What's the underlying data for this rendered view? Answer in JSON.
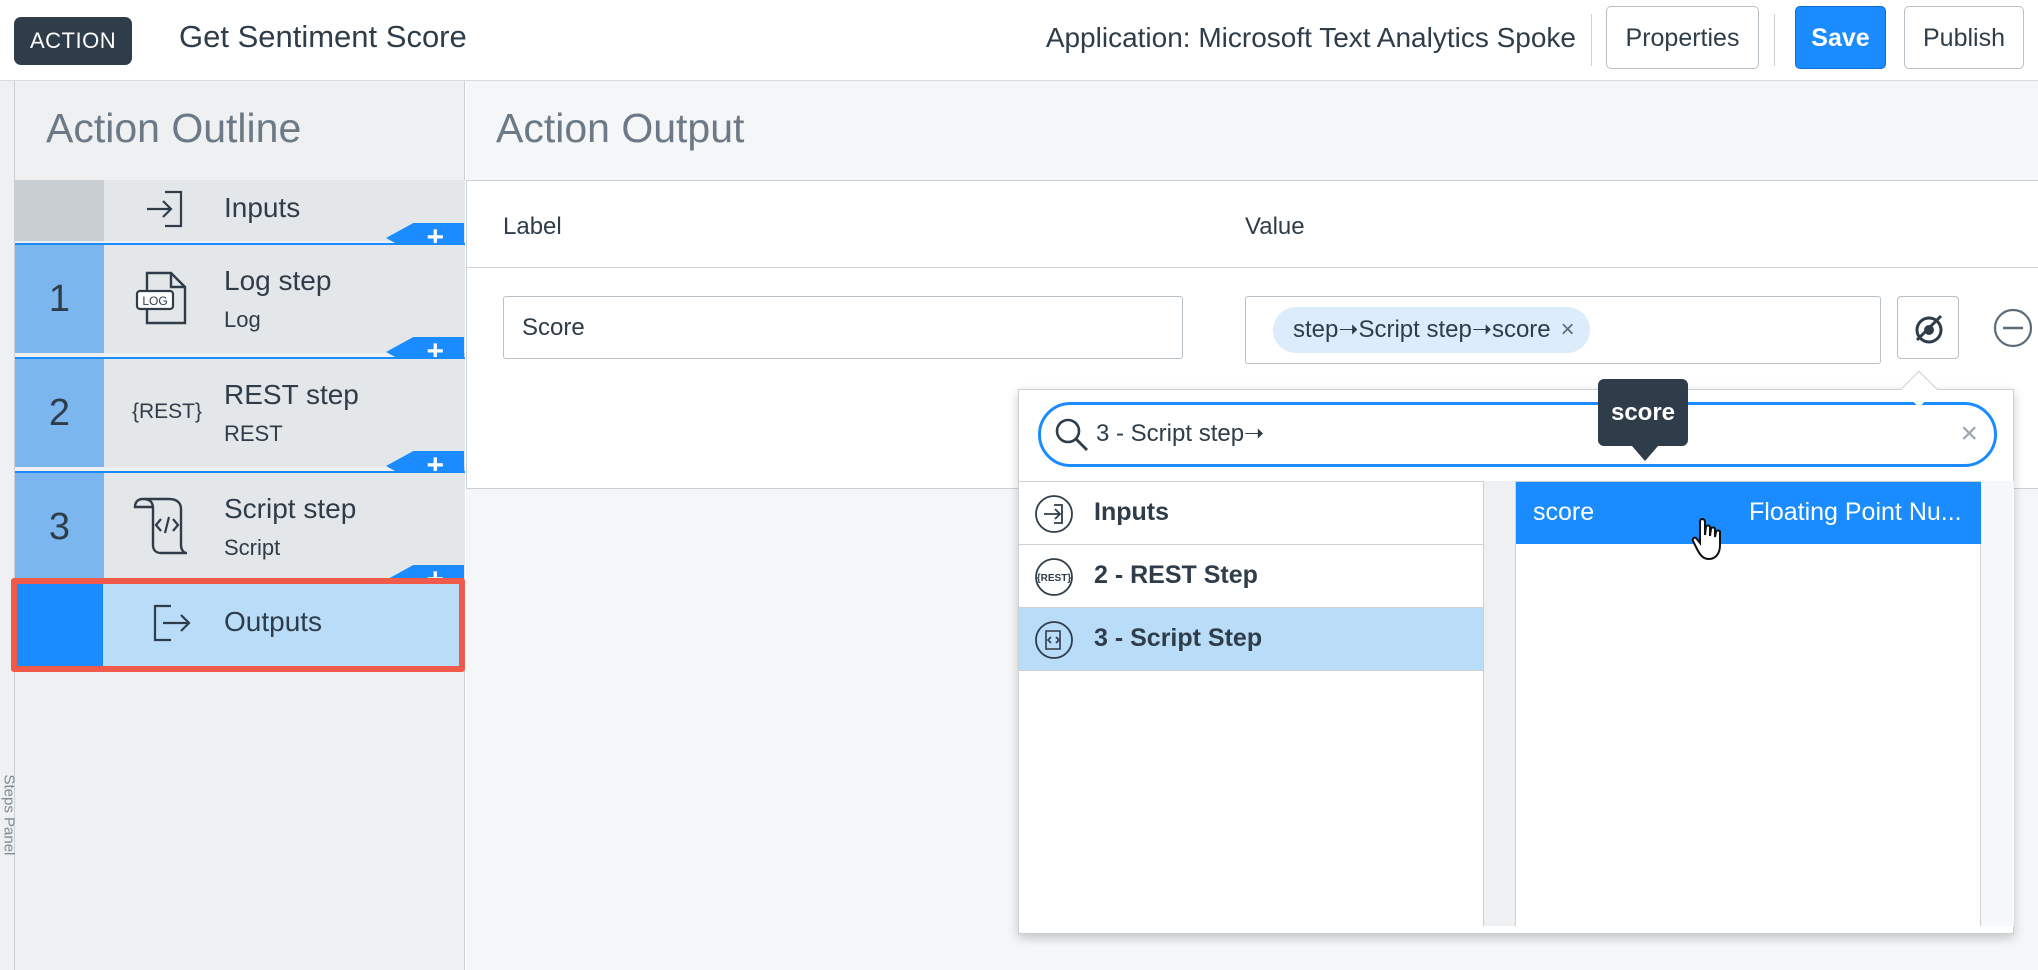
{
  "header": {
    "badge": "ACTION",
    "title": "Get Sentiment Score",
    "application": "Application: Microsoft Text Analytics Spoke",
    "buttons": {
      "properties": "Properties",
      "save": "Save",
      "publish": "Publish"
    }
  },
  "outline": {
    "title": "Action Outline",
    "inputs_label": "Inputs",
    "outputs_label": "Outputs",
    "steps": [
      {
        "num": "1",
        "name": "Log step",
        "type": "Log",
        "icon": "log-file-icon"
      },
      {
        "num": "2",
        "name": "REST step",
        "type": "REST",
        "icon": "rest-icon"
      },
      {
        "num": "3",
        "name": "Script step",
        "type": "Script",
        "icon": "script-scroll-icon"
      }
    ],
    "add_symbol": "+",
    "side_strip_text": "Steps Panel"
  },
  "output": {
    "title": "Action Output",
    "label_header": "Label",
    "value_header": "Value",
    "label_value": "Score",
    "value_pill": "step➝Script step➝score",
    "pill_remove": "×"
  },
  "picker": {
    "search_query": "3 - Script step➝",
    "clear": "×",
    "sources": [
      {
        "label": "Inputs",
        "icon": "arrow-in-icon"
      },
      {
        "label": "2 - REST Step",
        "icon": "rest-icon"
      },
      {
        "label": "3 - Script Step",
        "icon": "script-icon",
        "active": true
      }
    ],
    "fields": [
      {
        "name": "score",
        "type": "Floating Point Nu..."
      }
    ],
    "tooltip": "score"
  },
  "colors": {
    "primary": "#1a8cff",
    "step_number_bg": "#7bb6ee",
    "highlight": "#f05a4a",
    "selected_row": "#b9dcf8"
  }
}
